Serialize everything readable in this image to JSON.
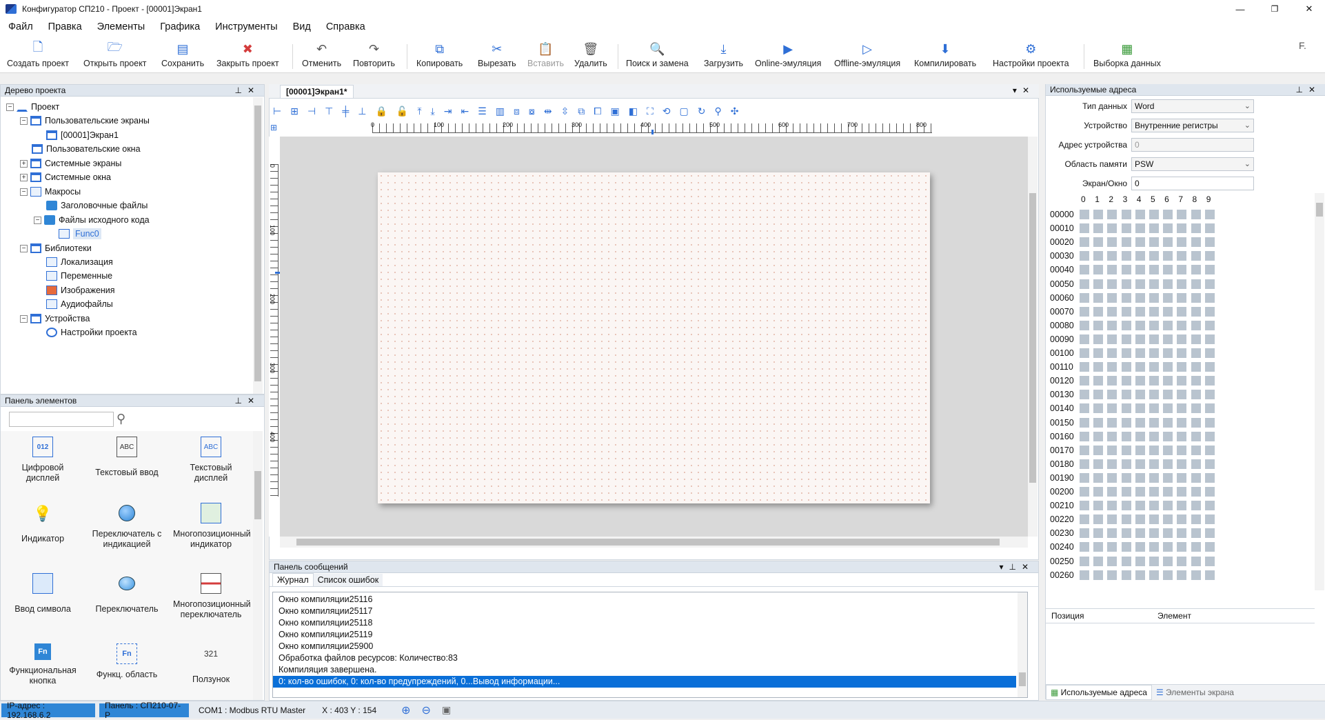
{
  "window": {
    "title": "Конфигуратор СП210 - Проект - [00001]Экран1",
    "min": "—",
    "max": "❐",
    "close": "✕"
  },
  "menu": [
    "Файл",
    "Правка",
    "Элементы",
    "Графика",
    "Инструменты",
    "Вид",
    "Справка"
  ],
  "toolbar": {
    "create": "Создать проект",
    "open": "Открыть проект",
    "save": "Сохранить",
    "close": "Закрыть проект",
    "undo": "Отменить",
    "redo": "Повторить",
    "copy": "Копировать",
    "cut": "Вырезать",
    "paste": "Вставить",
    "delete": "Удалить",
    "find": "Поиск и замена",
    "download": "Загрузить",
    "online": "Online-эмуляция",
    "offline": "Offline-эмуляция",
    "compile": "Компилировать",
    "settings": "Настройки проекта",
    "sampling": "Выборка данных"
  },
  "tree": {
    "header": "Дерево проекта",
    "items": [
      "Проект",
      "Пользовательские экраны",
      "[00001]Экран1",
      "Пользовательские окна",
      "Системные экраны",
      "Системные окна",
      "Макросы",
      "Заголовочные файлы",
      "Файлы исходного кода",
      "Func0",
      "Библиотеки",
      "Локализация",
      "Переменные",
      "Изображения",
      "Аудиофайлы",
      "Устройства",
      "Настройки проекта"
    ]
  },
  "elements_panel": {
    "header": "Панель элементов",
    "search_value": "",
    "items": [
      "Цифровой дисплей",
      "Текстовый ввод",
      "Текстовый дисплей",
      "Индикатор",
      "Переключатель с индикацией",
      "Многопозиционный индикатор",
      "Ввод символа",
      "Переключатель",
      "Многопозиционный переключатель",
      "Функциональная кнопка",
      "Функц. область",
      "Ползунок"
    ],
    "icon_texts": {
      "digital": "012",
      "textinput": "ABC",
      "textdisplay": "ABC",
      "fn1": "Fn",
      "fn2": "Fn",
      "slider": "321"
    }
  },
  "document": {
    "tab": "[00001]Экран1*",
    "ruler_h": [
      "0",
      "100",
      "200",
      "300",
      "400",
      "500",
      "600",
      "700",
      "800"
    ],
    "ruler_v": [
      "0",
      "100",
      "200",
      "300",
      "400"
    ]
  },
  "messages": {
    "header": "Панель сообщений",
    "tabs": [
      "Журнал",
      "Список ошибок"
    ],
    "lines": [
      "Окно компиляции25116",
      "Окно компиляции25117",
      "Окно компиляции25118",
      "Окно компиляции25119",
      "Окно компиляции25900",
      "Обработка файлов ресурсов: Количество:83",
      "Компиляция завершена."
    ],
    "selected_line": "0: кол-во ошибок,  0: кол-во предупреждений,  0...Вывод информации..."
  },
  "addresses": {
    "header": "Используемые адреса",
    "labels": {
      "type": "Тип данных",
      "device": "Устройство",
      "devaddr": "Адрес устройства",
      "area": "Область памяти",
      "screen": "Экран/Окно"
    },
    "values": {
      "type": "Word",
      "device": "Внутренние регистры",
      "devaddr": "0",
      "area": "PSW",
      "screen": "0"
    },
    "digits": [
      "0",
      "1",
      "2",
      "3",
      "4",
      "5",
      "6",
      "7",
      "8",
      "9"
    ],
    "rows": [
      "00000",
      "00010",
      "00020",
      "00030",
      "00040",
      "00050",
      "00060",
      "00070",
      "00080",
      "00090",
      "00100",
      "00110",
      "00120",
      "00130",
      "00140",
      "00150",
      "00160",
      "00170",
      "00180",
      "00190",
      "00200",
      "00210",
      "00220",
      "00230",
      "00240",
      "00250",
      "00260"
    ],
    "table_headers": [
      "Позиция",
      "Элемент"
    ],
    "bottom_tabs": [
      "Используемые адреса",
      "Элементы экрана"
    ]
  },
  "status": {
    "ip": "IP-адрес : 192.168.6.2",
    "panel": "Панель : СП210-07-Р",
    "com": "COM1 : Modbus RTU Master",
    "pos": "X : 403   Y : 154"
  }
}
